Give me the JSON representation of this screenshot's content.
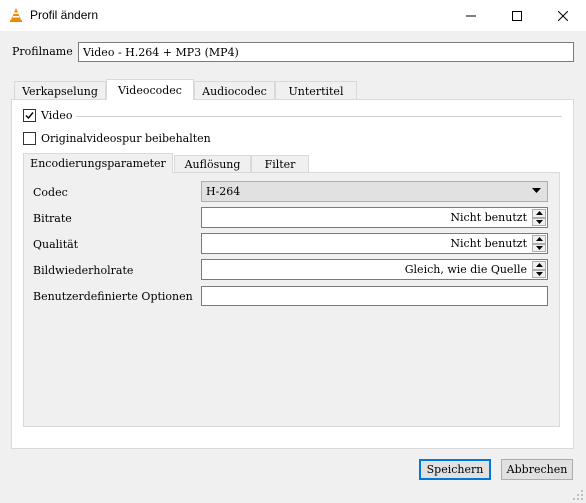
{
  "window": {
    "title": "Profil ändern"
  },
  "profile": {
    "label": "Profilname",
    "value": "Video - H.264 + MP3 (MP4)"
  },
  "tabs": [
    {
      "label": "Verkapselung",
      "active": false
    },
    {
      "label": "Videocodec",
      "active": true
    },
    {
      "label": "Audiocodec",
      "active": false
    },
    {
      "label": "Untertitel",
      "active": false
    }
  ],
  "video": {
    "checkbox_label": "Video",
    "checked": true,
    "keep_original_label": "Originalvideospur beibehalten",
    "keep_original_checked": false
  },
  "subtabs": [
    {
      "label": "Encodierungsparameter",
      "active": true
    },
    {
      "label": "Auflösung",
      "active": false
    },
    {
      "label": "Filter",
      "active": false
    }
  ],
  "params": {
    "codec_label": "Codec",
    "codec_value": "H-264",
    "bitrate_label": "Bitrate",
    "bitrate_value": "Nicht benutzt",
    "quality_label": "Qualität",
    "quality_value": "Nicht benutzt",
    "framerate_label": "Bildwiederholrate",
    "framerate_value": "Gleich, wie die Quelle",
    "custom_label": "Benutzerdefinierte Optionen",
    "custom_value": ""
  },
  "buttons": {
    "save": "Speichern",
    "cancel": "Abbrechen"
  },
  "colors": {
    "accent": "#0078d7",
    "vlc_orange": "#f08a00"
  }
}
